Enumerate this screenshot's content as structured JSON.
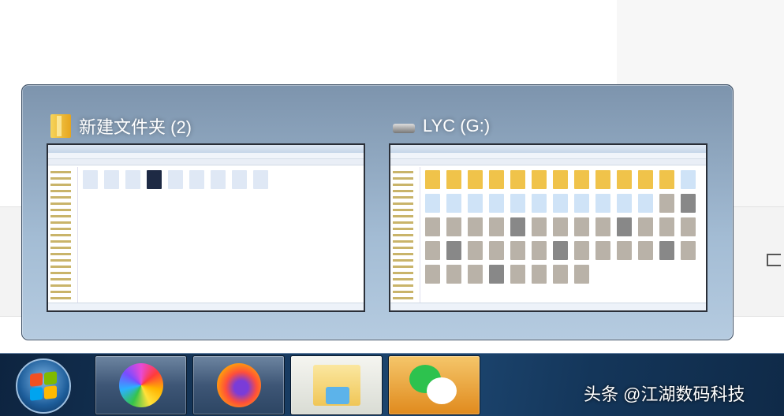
{
  "popup": {
    "windows": [
      {
        "title": "新建文件夹 (2)",
        "icon": "folder-icon"
      },
      {
        "title": "LYC (G:)",
        "icon": "drive-icon"
      }
    ]
  },
  "taskbar": {
    "items": [
      {
        "name": "start-button",
        "icon": "windows-orb-icon"
      },
      {
        "name": "colorful-browser",
        "icon": "pinwheel-browser-icon"
      },
      {
        "name": "firefox",
        "icon": "firefox-icon"
      },
      {
        "name": "windows-explorer",
        "icon": "explorer-folder-icon",
        "active": true
      },
      {
        "name": "wechat",
        "icon": "wechat-icon"
      }
    ]
  },
  "watermark": "头条 @江湖数码科技"
}
